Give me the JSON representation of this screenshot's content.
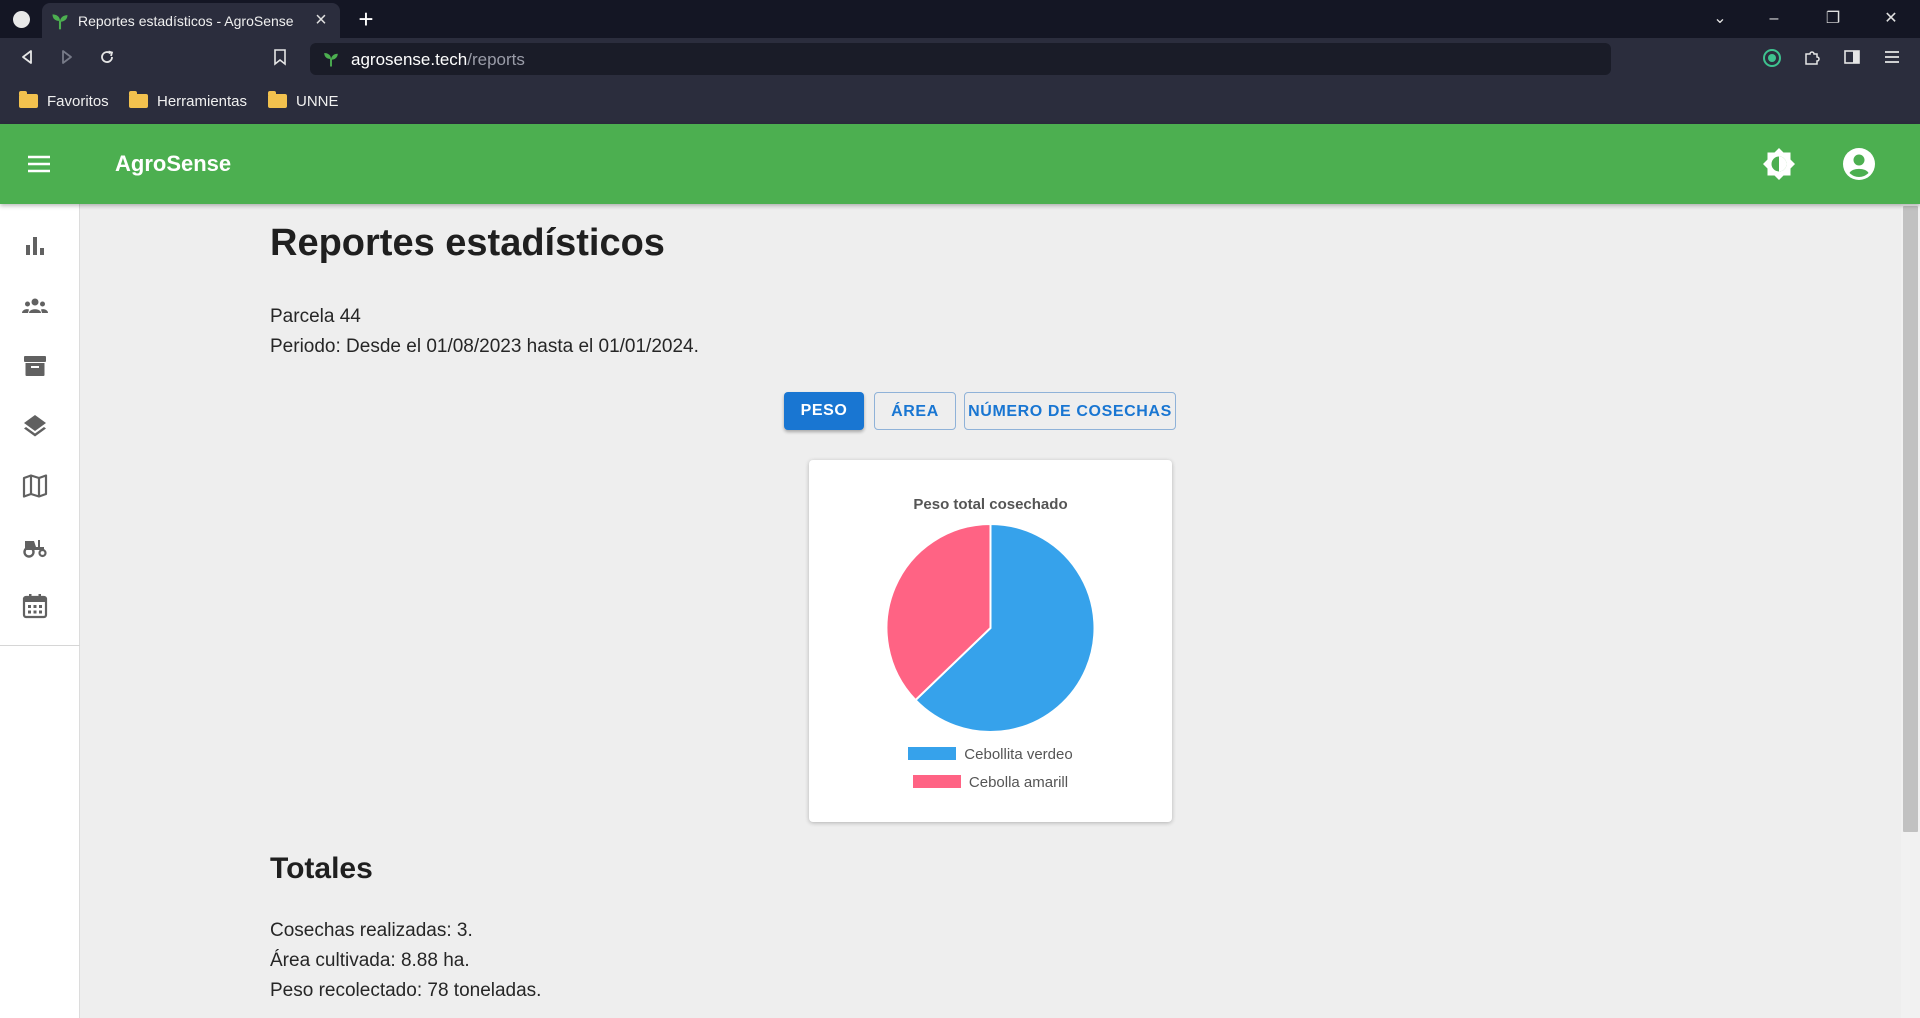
{
  "browser": {
    "tab_title": "Reportes estadísticos - AgroSense",
    "url_host": "agrosense.tech",
    "url_path": "/reports",
    "bookmarks": [
      {
        "label": "Favoritos"
      },
      {
        "label": "Herramientas"
      },
      {
        "label": "UNNE"
      }
    ]
  },
  "app": {
    "title": "AgroSense",
    "accent": "#4caf50",
    "sidebar": [
      {
        "name": "reports",
        "icon": "bar-chart-icon"
      },
      {
        "name": "users",
        "icon": "groups-icon"
      },
      {
        "name": "inventory",
        "icon": "archive-icon"
      },
      {
        "name": "layers",
        "icon": "layers-icon"
      },
      {
        "name": "map",
        "icon": "map-icon"
      },
      {
        "name": "machinery",
        "icon": "tractor-icon"
      },
      {
        "name": "calendar",
        "icon": "calendar-icon"
      }
    ]
  },
  "page": {
    "title": "Reportes estadísticos",
    "parcel": "Parcela 44",
    "period": "Periodo: Desde el 01/08/2023 hasta el 01/01/2024.",
    "tabs": {
      "peso": "PESO",
      "area": "ÁREA",
      "cosechas": "NÚMERO DE COSECHAS"
    },
    "totals": {
      "title": "Totales",
      "cosechas": "Cosechas realizadas: 3.",
      "area": "Área cultivada: 8.88 ha.",
      "peso": "Peso recolectado: 78 toneladas."
    }
  },
  "chart_data": {
    "type": "pie",
    "title": "Peso total cosechado",
    "categories": [
      "Cebollita verdeo",
      "Cebolla amarill"
    ],
    "values": [
      49,
      29
    ],
    "colors": [
      "#36a2eb",
      "#ff6384"
    ],
    "legend": "bottom"
  }
}
